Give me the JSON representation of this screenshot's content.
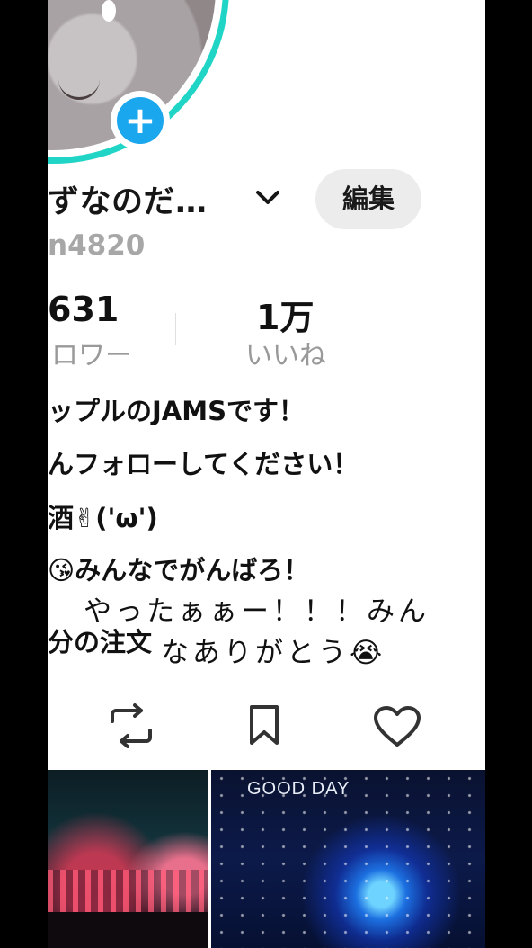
{
  "profile": {
    "display_name": "ずなのだ…",
    "handle": "n4820",
    "edit_label": "編集"
  },
  "stats": {
    "followers_count": "631",
    "followers_label": "ロワー",
    "likes_count": "1万",
    "likes_label": "いいね"
  },
  "bio": {
    "line1": "ップルのJAMSです！",
    "line2": "んフォローしてください！",
    "line3": "酒✌('ω')",
    "line4": "😘みんなでがんばろ！",
    "line5": "分の注文"
  },
  "overlay_caption": {
    "line1": "やったぁぁー！！！みん",
    "line2": "なありがとう😭"
  },
  "actions": [
    "repost-icon",
    "bookmark-icon",
    "heart-icon"
  ],
  "thumbnails": [
    {
      "caption": ""
    },
    {
      "caption": "GOOD DAY"
    }
  ],
  "colors": {
    "ring": "#20d5c6",
    "add_button": "#1aa7ee",
    "edit_bg": "#ececec",
    "muted_text": "#999999"
  }
}
